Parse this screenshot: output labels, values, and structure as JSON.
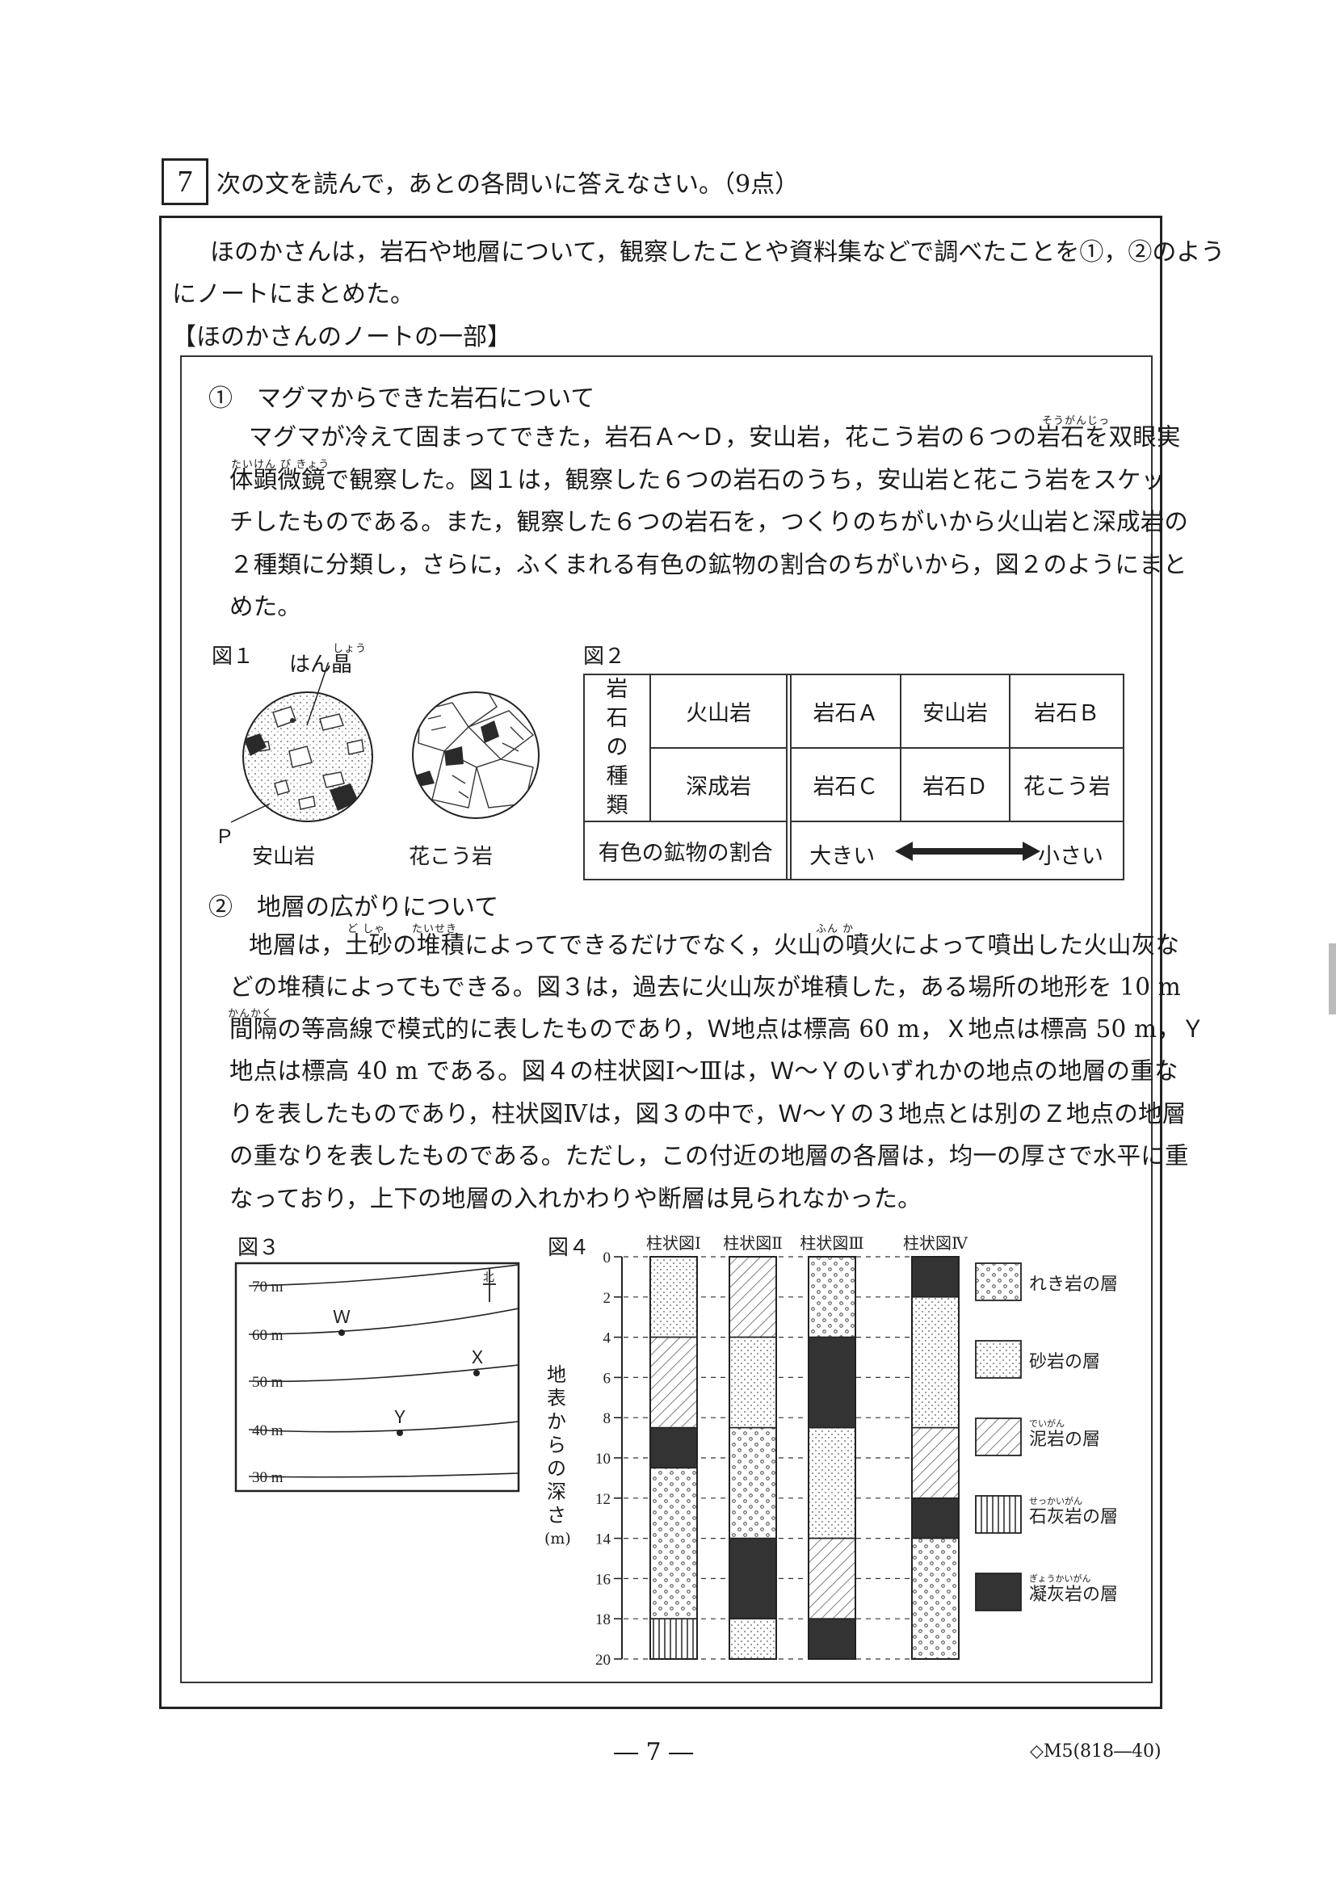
{
  "question": {
    "number": "7",
    "instruction": "次の文を読んで，あとの各問いに答えなさい。（9点）"
  },
  "intro": {
    "line1": "ほのかさんは，岩石や地層について，観察したことや資料集などで調べたことを①，②のよう",
    "line2": "にノートにまとめた。"
  },
  "note_title": "【ほのかさんのノートの一部】",
  "section1": {
    "title": "①　マグマからできた岩石について",
    "lines": [
      "マグマが冷えて固まってできた，岩石Ａ～Ｄ，安山岩，花こう岩の６つの岩石を双眼実",
      "体顕微鏡で観察した。図１は，観察した６つの岩石のうち，安山岩と花こう岩をスケッ",
      "チしたものである。また，観察した６つの岩石を，つくりのちがいから火山岩と深成岩の",
      "２種類に分類し，さらに，ふくまれる有色の鉱物の割合のちがいから，図２のようにまと",
      "めた。"
    ],
    "ruby_sougan": "そうがんじっ",
    "ruby_taiken": "たいけん び きょう"
  },
  "figure1": {
    "label": "図１",
    "phenocryst_label": "はん晶",
    "phenocryst_ruby": "しょう",
    "p_label": "Ｐ",
    "andesite_label": "安山岩",
    "granite_label": "花こう岩"
  },
  "figure2": {
    "label": "図２",
    "type_header": "岩石の種類",
    "volcanic": "火山岩",
    "plutonic": "深成岩",
    "row1": [
      "岩石Ａ",
      "安山岩",
      "岩石Ｂ"
    ],
    "row2": [
      "岩石Ｃ",
      "岩石Ｄ",
      "花こう岩"
    ],
    "ratio_label": "有色の鉱物の割合",
    "large": "大きい",
    "small": "小さい"
  },
  "section2": {
    "title": "②　地層の広がりについて",
    "lines": [
      "地層は，土砂の堆積によってできるだけでなく，火山の噴火によって噴出した火山灰な",
      "どの堆積によってもできる。図３は，過去に火山灰が堆積した，ある場所の地形を 10 m",
      "間隔の等高線で模式的に表したものであり，Ｗ地点は標高 60 m，Ｘ地点は標高 50 m，Ｙ",
      "地点は標高 40 m である。図４の柱状図Ⅰ～Ⅲは，Ｗ～Ｙのいずれかの地点の地層の重な",
      "りを表したものであり，柱状図Ⅳは，図３の中で，Ｗ～Ｙの３地点とは別のＺ地点の地層",
      "の重なりを表したものである。ただし，この付近の地層の各層は，均一の厚さで水平に重",
      "なっており，上下の地層の入れかわりや断層は見られなかった。"
    ],
    "ruby_dosha": "ど しゃ",
    "ruby_taiseki": "たいせき",
    "ruby_funka": "ふん か",
    "ruby_kankaku": "かんかく"
  },
  "figure3": {
    "label": "図３",
    "contours": [
      "70 m",
      "60 m",
      "50 m",
      "40 m",
      "30 m"
    ],
    "north": "北",
    "points": [
      "Ｗ",
      "Ｘ",
      "Ｙ"
    ]
  },
  "figure4": {
    "label": "図４",
    "axis_label": [
      "地",
      "表",
      "か",
      "ら",
      "の",
      "深",
      "さ",
      "(m)"
    ],
    "ticks": [
      "0",
      "2",
      "4",
      "6",
      "8",
      "10",
      "12",
      "14",
      "16",
      "18",
      "20"
    ],
    "columns": [
      {
        "name": "柱状図Ⅰ",
        "layers": [
          [
            "sandstone",
            0,
            4
          ],
          [
            "mudstone",
            4,
            8.5
          ],
          [
            "tuff",
            8.5,
            10.5
          ],
          [
            "conglomerate",
            10.5,
            18
          ],
          [
            "limestone",
            18,
            20
          ]
        ]
      },
      {
        "name": "柱状図Ⅱ",
        "layers": [
          [
            "mudstone",
            0,
            4
          ],
          [
            "sandstone",
            4,
            8.5
          ],
          [
            "conglomerate",
            8.5,
            14
          ],
          [
            "tuff",
            14,
            18
          ],
          [
            "sandstone",
            18,
            20
          ]
        ]
      },
      {
        "name": "柱状図Ⅲ",
        "layers": [
          [
            "conglomerate",
            0,
            4
          ],
          [
            "tuff",
            4,
            8.5
          ],
          [
            "sandstone",
            8.5,
            14
          ],
          [
            "mudstone",
            14,
            18
          ],
          [
            "tuff",
            18,
            20
          ]
        ]
      },
      {
        "name": "柱状図Ⅳ",
        "layers": [
          [
            "tuff",
            0,
            2
          ],
          [
            "sandstone",
            2,
            8.5
          ],
          [
            "mudstone",
            8.5,
            12
          ],
          [
            "tuff",
            12,
            14
          ],
          [
            "conglomerate",
            14,
            20
          ]
        ]
      }
    ],
    "legend": [
      {
        "type": "conglomerate",
        "label": "れき岩の層",
        "ruby": ""
      },
      {
        "type": "sandstone",
        "label": "砂岩の層",
        "ruby": ""
      },
      {
        "type": "mudstone",
        "label": "泥岩の層",
        "ruby": "でいがん"
      },
      {
        "type": "limestone",
        "label": "石灰岩の層",
        "ruby": "せっかいがん"
      },
      {
        "type": "tuff",
        "label": "凝灰岩の層",
        "ruby": "ぎょうかいがん"
      }
    ]
  },
  "footer": {
    "page": "― 7 ―",
    "code": "◇M5(818―40)"
  }
}
